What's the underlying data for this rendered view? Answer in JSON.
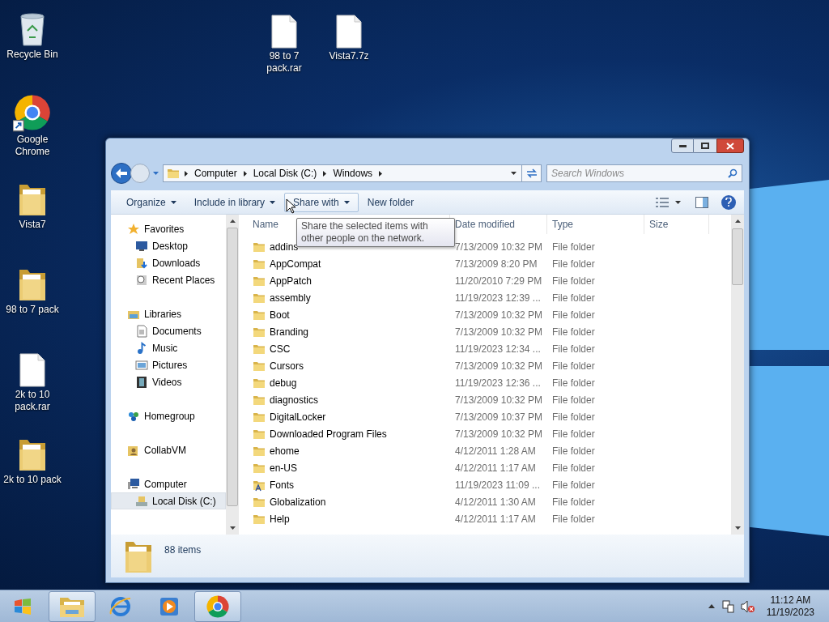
{
  "desktop": {
    "column_icons": [
      {
        "label": "Recycle Bin",
        "kind": "recycle-bin"
      },
      {
        "label": "Google Chrome",
        "kind": "chrome-shortcut"
      },
      {
        "label": "Vista7",
        "kind": "folder"
      },
      {
        "label": "98 to 7 pack",
        "kind": "folder"
      },
      {
        "label": "2k to 10 pack.rar",
        "kind": "file"
      },
      {
        "label": "2k to 10 pack",
        "kind": "folder"
      }
    ],
    "top_icons": [
      {
        "label": "98 to 7 pack.rar",
        "kind": "file"
      },
      {
        "label": "Vista7.7z",
        "kind": "file"
      }
    ]
  },
  "window": {
    "address": {
      "crumbs": [
        "Computer",
        "Local Disk (C:)",
        "Windows"
      ]
    },
    "search": {
      "placeholder": "Search Windows"
    },
    "toolbar": [
      {
        "label": "Organize",
        "dropdown": true,
        "hovered": false
      },
      {
        "label": "Include in library",
        "dropdown": true,
        "hovered": false
      },
      {
        "label": "Share with",
        "dropdown": true,
        "hovered": true
      },
      {
        "label": "New folder",
        "dropdown": false,
        "hovered": false
      }
    ],
    "tooltip": "Share the selected items with other people on the network.",
    "sidebar": [
      {
        "label": "Favorites",
        "kind": "favorites",
        "selected": false,
        "children": [
          {
            "label": "Desktop",
            "kind": "desktop",
            "selected": false
          },
          {
            "label": "Downloads",
            "kind": "downloads",
            "selected": false
          },
          {
            "label": "Recent Places",
            "kind": "recent",
            "selected": false
          }
        ]
      },
      {
        "label": "Libraries",
        "kind": "libraries",
        "selected": false,
        "children": [
          {
            "label": "Documents",
            "kind": "documents",
            "selected": false
          },
          {
            "label": "Music",
            "kind": "music",
            "selected": false
          },
          {
            "label": "Pictures",
            "kind": "pictures",
            "selected": false
          },
          {
            "label": "Videos",
            "kind": "videos",
            "selected": false
          }
        ]
      },
      {
        "label": "Homegroup",
        "kind": "homegroup",
        "selected": false
      },
      {
        "label": "CollabVM",
        "kind": "user",
        "selected": false
      },
      {
        "label": "Computer",
        "kind": "computer",
        "selected": false,
        "children": [
          {
            "label": "Local Disk (C:)",
            "kind": "disk",
            "selected": true
          }
        ]
      }
    ],
    "table": {
      "columns": [
        "Name",
        "Date modified",
        "Type",
        "Size"
      ],
      "rows": [
        {
          "name": "addins",
          "kind": "folder",
          "date": "7/13/2009 10:32 PM",
          "type": "File folder"
        },
        {
          "name": "AppCompat",
          "kind": "folder",
          "date": "7/13/2009 8:20 PM",
          "type": "File folder"
        },
        {
          "name": "AppPatch",
          "kind": "folder",
          "date": "11/20/2010 7:29 PM",
          "type": "File folder"
        },
        {
          "name": "assembly",
          "kind": "folder",
          "date": "11/19/2023 12:39 ...",
          "type": "File folder"
        },
        {
          "name": "Boot",
          "kind": "folder",
          "date": "7/13/2009 10:32 PM",
          "type": "File folder"
        },
        {
          "name": "Branding",
          "kind": "folder",
          "date": "7/13/2009 10:32 PM",
          "type": "File folder"
        },
        {
          "name": "CSC",
          "kind": "folder",
          "date": "11/19/2023 12:34 ...",
          "type": "File folder"
        },
        {
          "name": "Cursors",
          "kind": "folder",
          "date": "7/13/2009 10:32 PM",
          "type": "File folder"
        },
        {
          "name": "debug",
          "kind": "folder",
          "date": "11/19/2023 12:36 ...",
          "type": "File folder"
        },
        {
          "name": "diagnostics",
          "kind": "folder",
          "date": "7/13/2009 10:32 PM",
          "type": "File folder"
        },
        {
          "name": "DigitalLocker",
          "kind": "folder",
          "date": "7/13/2009 10:37 PM",
          "type": "File folder"
        },
        {
          "name": "Downloaded Program Files",
          "kind": "folder",
          "date": "7/13/2009 10:32 PM",
          "type": "File folder"
        },
        {
          "name": "ehome",
          "kind": "folder",
          "date": "4/12/2011 1:28 AM",
          "type": "File folder"
        },
        {
          "name": "en-US",
          "kind": "folder",
          "date": "4/12/2011 1:17 AM",
          "type": "File folder"
        },
        {
          "name": "Fonts",
          "kind": "fonts",
          "date": "11/19/2023 11:09 ...",
          "type": "File folder"
        },
        {
          "name": "Globalization",
          "kind": "folder",
          "date": "4/12/2011 1:30 AM",
          "type": "File folder"
        },
        {
          "name": "Help",
          "kind": "folder",
          "date": "4/12/2011 1:17 AM",
          "type": "File folder"
        }
      ]
    },
    "status": {
      "count": "88 items"
    }
  },
  "taskbar": {
    "buttons": [
      {
        "kind": "explorer",
        "running": true
      },
      {
        "kind": "ie",
        "running": false
      },
      {
        "kind": "media-player",
        "running": false
      },
      {
        "kind": "chrome",
        "running": true
      }
    ],
    "clock": {
      "time": "11:12 AM",
      "date": "11/19/2023"
    }
  }
}
